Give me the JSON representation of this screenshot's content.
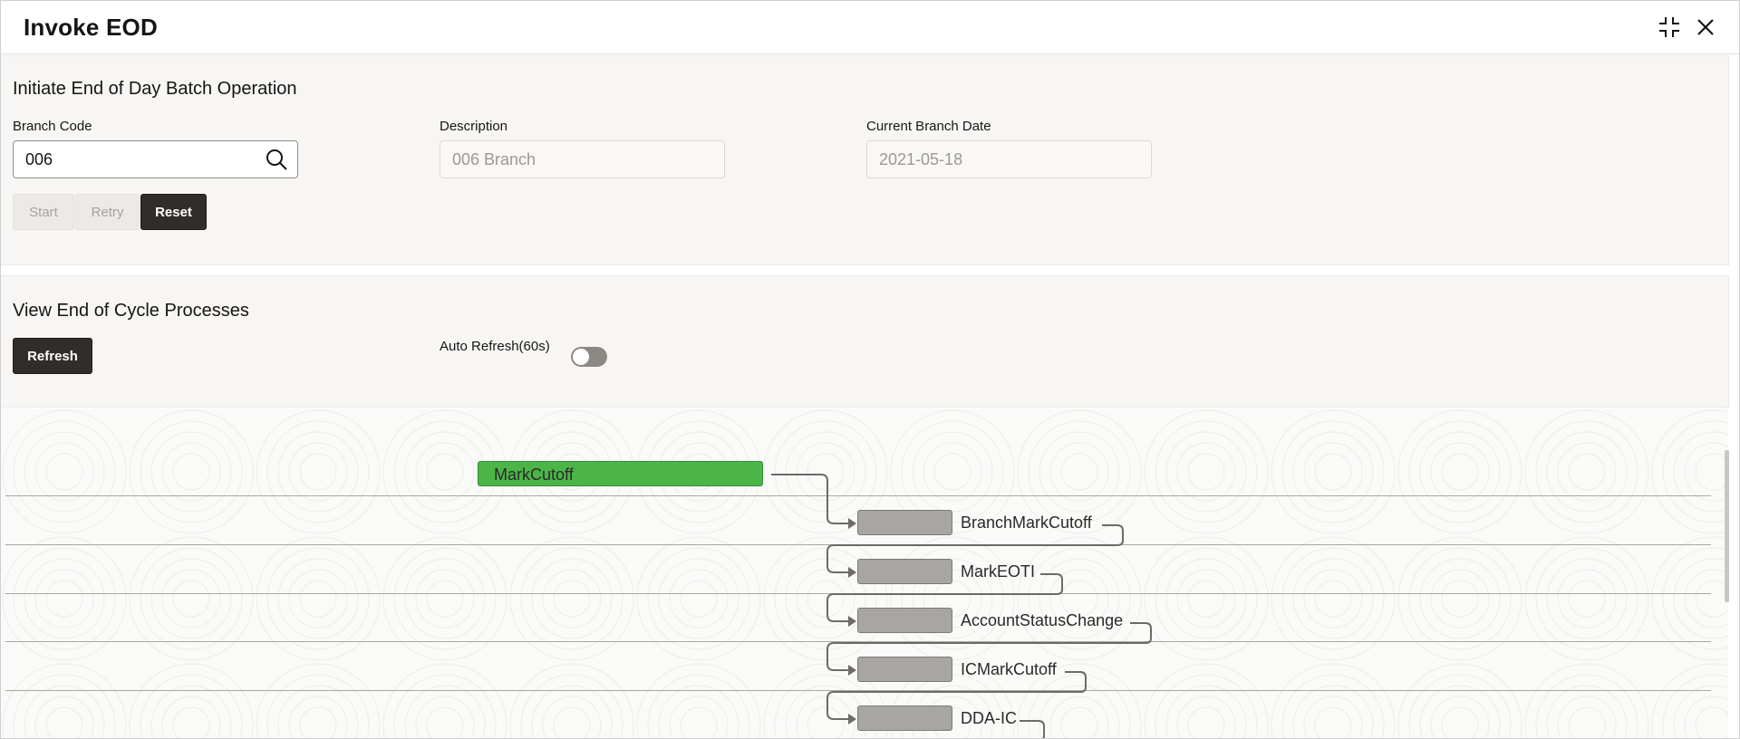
{
  "window": {
    "title": "Invoke EOD",
    "icons": {
      "minimize": "collapse-icon",
      "close": "close-icon"
    }
  },
  "initiate": {
    "heading": "Initiate End of Day Batch Operation",
    "branch_code_label": "Branch Code",
    "branch_code_value": "006",
    "description_label": "Description",
    "description_value": "006 Branch",
    "current_date_label": "Current Branch Date",
    "current_date_value": "2021-05-18",
    "buttons": {
      "start": "Start",
      "retry": "Retry",
      "reset": "Reset"
    }
  },
  "view": {
    "heading": "View End of Cycle Processes",
    "refresh_label": "Refresh",
    "auto_refresh_label": "Auto Refresh(60s)",
    "auto_refresh_on": false
  },
  "processes": [
    {
      "name": "MarkCutoff",
      "status": "completed"
    },
    {
      "name": "BranchMarkCutoff",
      "status": "pending"
    },
    {
      "name": "MarkEOTI",
      "status": "pending"
    },
    {
      "name": "AccountStatusChange",
      "status": "pending"
    },
    {
      "name": "ICMarkCutoff",
      "status": "pending"
    },
    {
      "name": "DDA-IC",
      "status": "pending"
    }
  ],
  "colors": {
    "completed": "#4bb548",
    "pending": "#a8a6a3",
    "primary_button": "#312d2a"
  }
}
